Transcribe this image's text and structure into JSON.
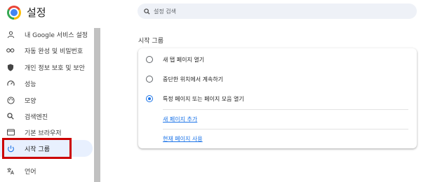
{
  "app": {
    "title": "설정"
  },
  "search": {
    "placeholder": "설정 검색"
  },
  "sidebar": {
    "items": [
      {
        "label": "내 Google 서비스 설정",
        "icon": "person-icon"
      },
      {
        "label": "자동 완성 및 비밀번호",
        "icon": "key-icon"
      },
      {
        "label": "개인 정보 보호 및 보안",
        "icon": "shield-icon"
      },
      {
        "label": "성능",
        "icon": "speedometer-icon"
      },
      {
        "label": "모양",
        "icon": "palette-icon"
      },
      {
        "label": "검색엔진",
        "icon": "search-icon"
      },
      {
        "label": "기본 브라우저",
        "icon": "browser-icon"
      },
      {
        "label": "시작 그룹",
        "icon": "power-icon",
        "active": true
      },
      {
        "label": "언어",
        "icon": "translate-icon"
      }
    ]
  },
  "main": {
    "section_title": "시작 그룹",
    "options": [
      {
        "label": "새 탭 페이지 열기",
        "checked": false
      },
      {
        "label": "중단한 위치에서 계속하기",
        "checked": false
      },
      {
        "label": "특정 페이지 또는 페이지 모음 열기",
        "checked": true
      }
    ],
    "links": {
      "add_page": "새 페이지 추가",
      "use_current": "현재 페이지 사용"
    }
  },
  "colors": {
    "accent": "#1a73e8",
    "highlight": "#cc0000",
    "active_bg": "#e8f0fe"
  }
}
